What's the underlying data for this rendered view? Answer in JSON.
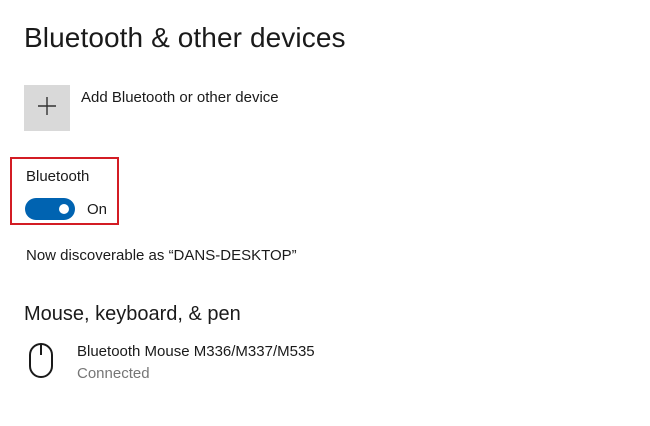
{
  "page": {
    "title": "Bluetooth & other devices"
  },
  "add_device": {
    "label": "Add Bluetooth or other device",
    "icon": "plus-icon"
  },
  "bluetooth": {
    "label": "Bluetooth",
    "toggle_state": "On",
    "enabled": true,
    "discoverable_text": "Now discoverable as “DANS-DESKTOP”"
  },
  "mouse_section": {
    "title": "Mouse, keyboard, & pen",
    "devices": [
      {
        "name": "Bluetooth Mouse M336/M337/M535",
        "status": "Connected",
        "icon": "mouse-icon"
      }
    ]
  },
  "colors": {
    "accent": "#0063b1",
    "highlight_border": "#d31c24",
    "tile_background": "#d9d9d9",
    "secondary_text": "#767676"
  }
}
